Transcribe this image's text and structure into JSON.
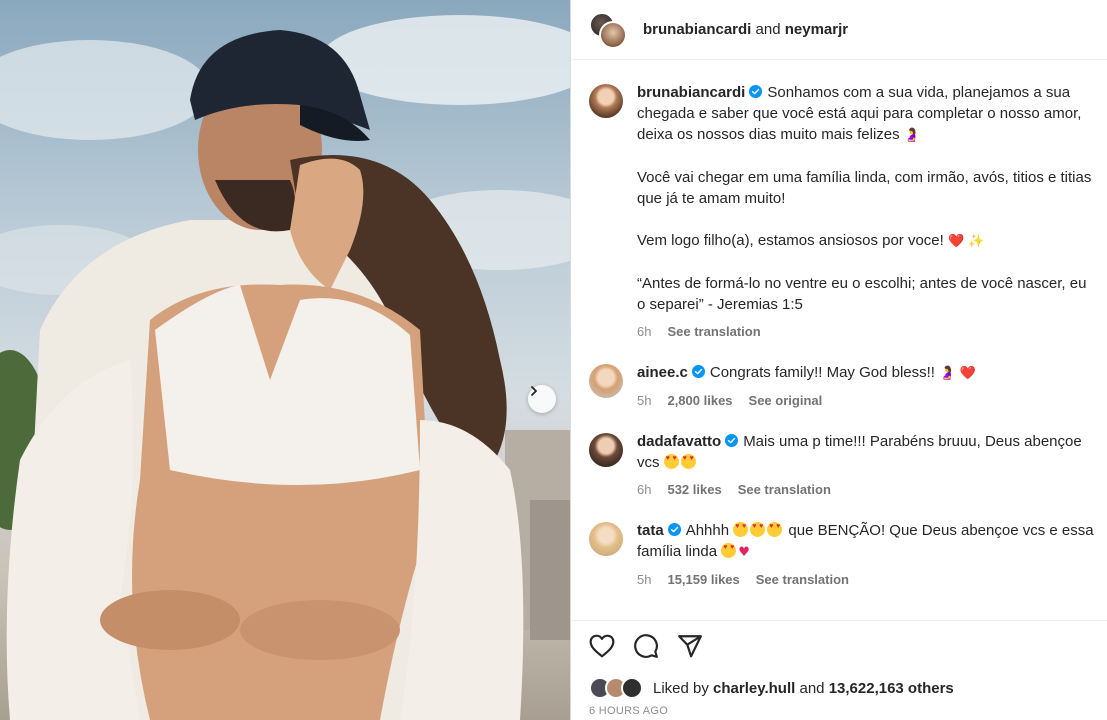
{
  "header": {
    "user1": "brunabiancardi",
    "connector": "and",
    "user2": "neymarjr"
  },
  "caption": {
    "username": "brunabiancardi",
    "p1": "Sonhamos com a sua vida, planejamos a sua chegada e saber que você está aqui para completar o nosso amor, deixa os nossos dias muito mais felizes",
    "p1_emoji": "🤰",
    "p2": "Você vai chegar em uma família linda, com irmão, avós, titios e titias que já te amam muito!",
    "p3": "Vem logo filho(a), estamos ansiosos por voce!",
    "p3_emoji_heart": "❤️",
    "p3_emoji_sparkles": "✨",
    "p4": "“Antes de formá-lo no ventre eu o escolhi; antes de você nascer, eu o separei” - Jeremias 1:5",
    "time": "6h",
    "translate": "See translation"
  },
  "comments": [
    {
      "username": "ainee.c",
      "text": "Congrats family!! May God bless!!",
      "emojis": "🤰 ❤️",
      "time": "5h",
      "likes": "2,800 likes",
      "action": "See original"
    },
    {
      "username": "dadafavatto",
      "text": "Mais uma p time!!! Parabéns bruuu, Deus abençoe vcs",
      "time": "6h",
      "likes": "532 likes",
      "action": "See translation"
    },
    {
      "username": "tata",
      "text_a": "Ahhhh",
      "text_b": "que BENÇÃO! Que Deus abençoe vcs e essa família linda",
      "time": "5h",
      "likes": "15,159 likes",
      "action": "See translation"
    }
  ],
  "likes": {
    "prefix": "Liked by",
    "user": "charley.hull",
    "connector": "and",
    "others": "13,622,163 others"
  },
  "timestamp": "6 HOURS AGO",
  "icons": [
    "heart-icon",
    "comment-icon",
    "share-icon",
    "verified-badge-icon",
    "chevron-right-icon"
  ],
  "colors": {
    "verified": "#0095f6",
    "heart": "#e0245e",
    "muted": "#8e8e8e"
  }
}
